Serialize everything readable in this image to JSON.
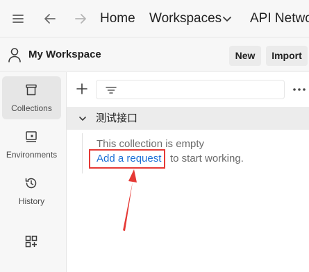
{
  "topbar": {
    "home_label": "Home",
    "workspaces_label": "Workspaces",
    "api_network_label": "API Netwo"
  },
  "workspace": {
    "title": "My Workspace",
    "new_label": "New",
    "import_label": "Import"
  },
  "sidebar": {
    "items": [
      {
        "label": "Collections",
        "icon": "collections-icon",
        "active": true
      },
      {
        "label": "Environments",
        "icon": "environments-icon",
        "active": false
      },
      {
        "label": "History",
        "icon": "history-icon",
        "active": false
      },
      {
        "label": "",
        "icon": "add-apps-icon",
        "active": false
      }
    ]
  },
  "collection": {
    "name": "测试接口",
    "empty_message": "This collection is empty",
    "add_request_link": "Add a request",
    "rest_text": "to start working."
  },
  "colors": {
    "link": "#1a6fd6",
    "annotation": "#e53935"
  }
}
